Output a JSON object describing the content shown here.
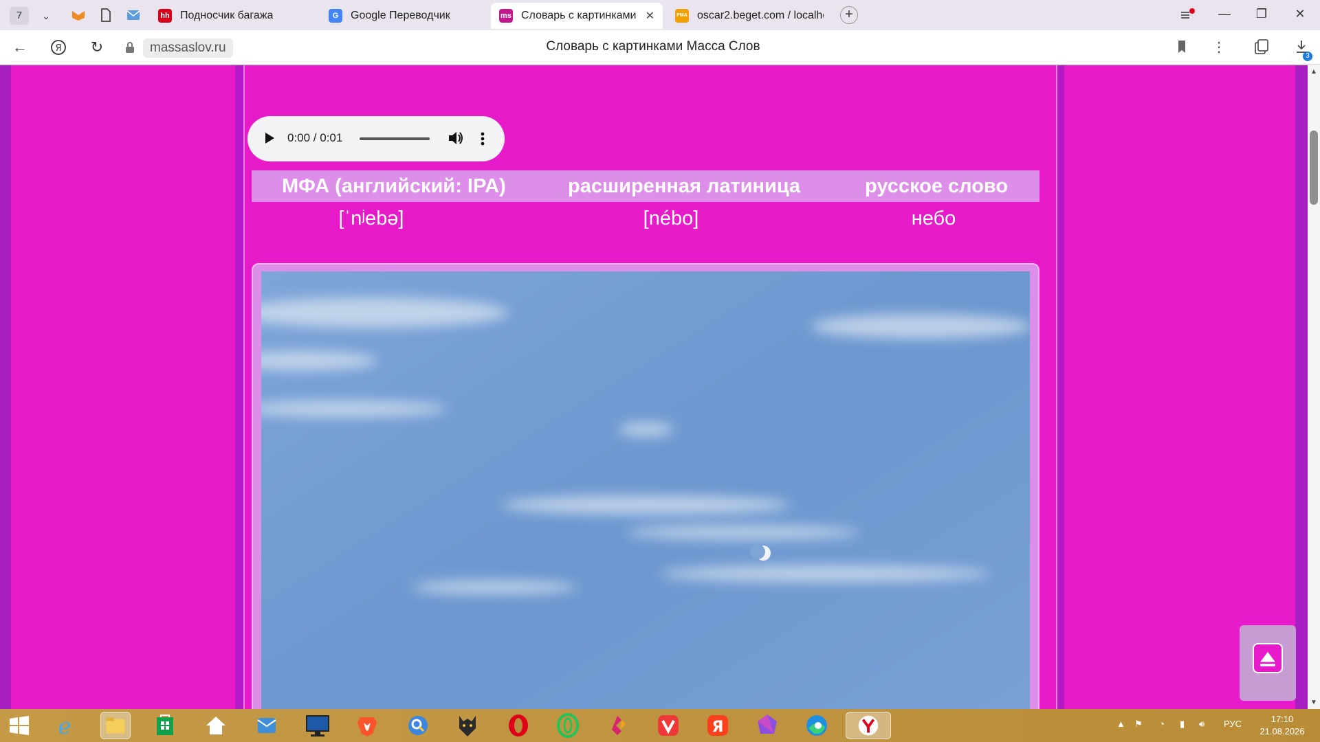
{
  "browser": {
    "tab_count": "7",
    "tabs": [
      {
        "title": "Подносчик багажа",
        "favicon_text": "hh",
        "favicon_color": "#d6001c"
      },
      {
        "title": "Google Переводчик",
        "favicon_text": "G",
        "favicon_color": "#4285f4"
      },
      {
        "title": "Словарь с картинками",
        "favicon_text": "ms",
        "favicon_color": "#c2188e",
        "active": true
      },
      {
        "title": "oscar2.beget.com / localho",
        "favicon_text": "PMA",
        "favicon_color": "#f0a000"
      }
    ],
    "new_tab_label": "+",
    "url": "massaslov.ru",
    "page_title": "Словарь с картинками Масса Слов",
    "downloads_badge": "3"
  },
  "audio": {
    "time": "0:00 / 0:01"
  },
  "table": {
    "headers": [
      "МФА (английский: IPA)",
      "расширенная латиница",
      "русское слово"
    ],
    "values": [
      "[ˈnʲebə]",
      "[nébo]",
      "небо"
    ]
  },
  "image": {
    "subject": "sky-with-moon"
  },
  "taskbar": {
    "language": "РУС",
    "time": "17:10",
    "date": "21.08.2026"
  },
  "colors": {
    "page_bg": "#e61ac8",
    "header_row_bg": "#dc8ee8",
    "side_stripe": "#a71ec1",
    "taskbar": "#c59a47"
  }
}
